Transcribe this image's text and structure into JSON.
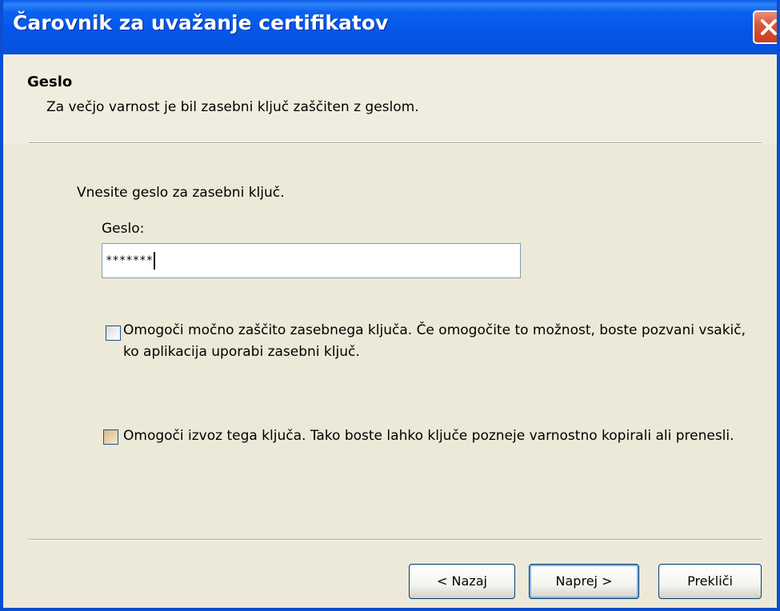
{
  "window": {
    "title": "Čarovnik za uvažanje certifikatov"
  },
  "header": {
    "title": "Geslo",
    "subtitle": "Za večjo varnost je bil zasebni ključ zaščiten z geslom."
  },
  "main": {
    "prompt": "Vnesite geslo za zasebni ključ.",
    "password_label": "Geslo:",
    "password_value": "*******",
    "checkbox_strong_protection": {
      "label": "Omogoči močno zaščito zasebnega ključa. Če omogočite to možnost, boste pozvani vsakič, ko aplikacija uporabi zasebni ključ.",
      "checked": false
    },
    "checkbox_exportable": {
      "label": "Omogoči izvoz tega ključa. Tako boste lahko ključe pozneje varnostno kopirali ali prenesli.",
      "checked": false
    }
  },
  "buttons": {
    "back_label": "< Nazaj",
    "next_label": "Naprej >",
    "cancel_label": "Prekliči"
  },
  "icons": {
    "close": "close-icon"
  },
  "colors": {
    "titlebar": "#0556e8",
    "dialog_background": "#ece9d8",
    "close_button": "#d9573a"
  }
}
